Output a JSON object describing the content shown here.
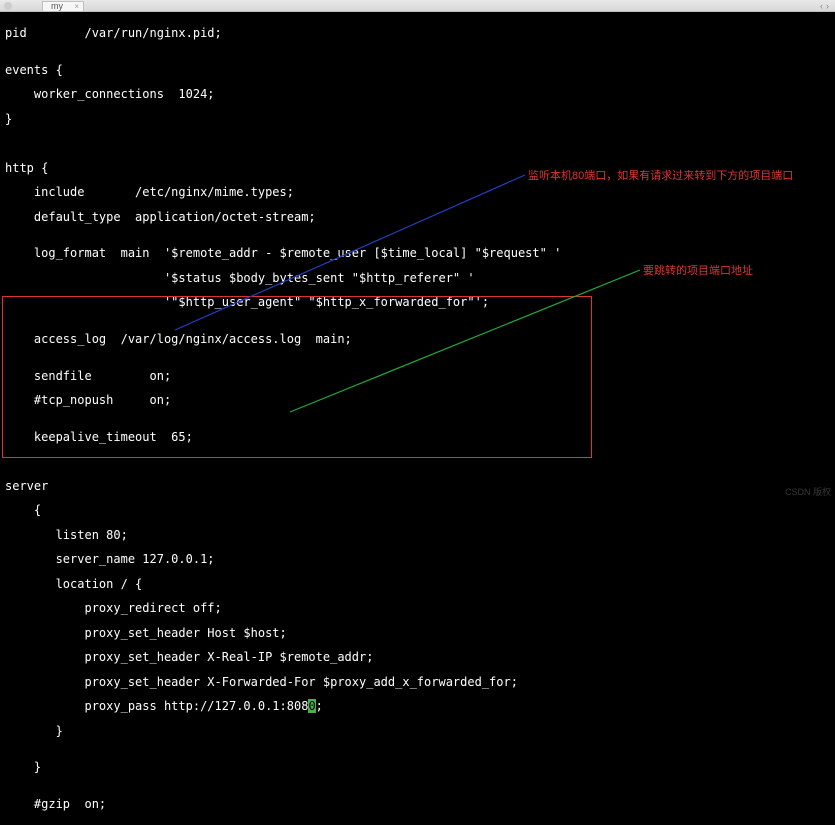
{
  "window": {
    "tab_title": "my",
    "tab_close": "×",
    "chev_left": "‹",
    "chev_right": "›"
  },
  "code": {
    "l1": "pid        /var/run/nginx.pid;",
    "l2": "",
    "l3": "events {",
    "l4": "    worker_connections  1024;",
    "l5": "}",
    "l6": "",
    "l7": "",
    "l8": "http {",
    "l9": "    include       /etc/nginx/mime.types;",
    "l10": "    default_type  application/octet-stream;",
    "l11": "",
    "l12": "    log_format  main  '$remote_addr - $remote_user [$time_local] \"$request\" '",
    "l13": "                      '$status $body_bytes_sent \"$http_referer\" '",
    "l14": "                      '\"$http_user_agent\" \"$http_x_forwarded_for\"';",
    "l15": "",
    "l16": "    access_log  /var/log/nginx/access.log  main;",
    "l17": "",
    "l18": "    sendfile        on;",
    "l19": "    #tcp_nopush     on;",
    "l20": "",
    "l21": "    keepalive_timeout  65;",
    "l22": "",
    "l23": "",
    "l24": "server",
    "l25": "    {",
    "l26": "       listen 80;",
    "l27": "       server_name 127.0.0.1;",
    "l28": "       location / {",
    "l29": "           proxy_redirect off;",
    "l30": "           proxy_set_header Host $host;",
    "l31": "           proxy_set_header X-Real-IP $remote_addr;",
    "l32": "           proxy_set_header X-Forwarded-For $proxy_add_x_forwarded_for;",
    "l33a": "           proxy_pass http://127.0.0.1:808",
    "l33b": "0",
    "l33c": ";",
    "l34": "       }",
    "l35": "",
    "l36": "    }",
    "l37": "",
    "l38": "    #gzip  on;"
  },
  "annot": {
    "a1": "监听本机80端口，如果有请求过来转到下方的项目端口",
    "a2": "要跳转的项目端口地址"
  },
  "watermark": "CSDN 版权"
}
